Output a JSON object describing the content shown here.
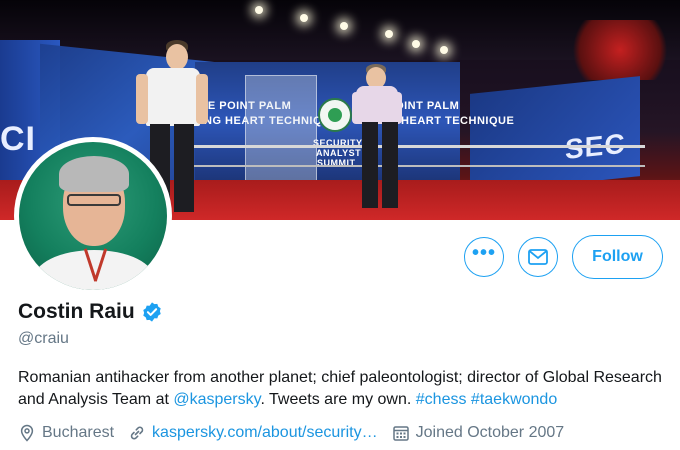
{
  "profile": {
    "display_name": "Costin Raiu",
    "handle": "@craiu",
    "verified_icon": "verified-badge-icon",
    "bio": {
      "text_1": "Romanian antihacker from another planet; chief paleontologist; director of Global Research and Analysis Team at ",
      "mention": "@kaspersky",
      "text_2": ". Tweets are my own. ",
      "hashtag_1": "#chess",
      "hashtag_2": "#taekwondo"
    },
    "location": "Bucharest",
    "website": "kaspersky.com/about/security…",
    "joined": "Joined October 2007"
  },
  "actions": {
    "more_label": "•••",
    "message_icon": "envelope-icon",
    "follow_label": "Follow"
  },
  "banner": {
    "screen_center_line1": "VE POINT PALM",
    "screen_center_line2": "DING HEART TECHNIQUE",
    "screen_left_line1": "VE POINT PALM",
    "screen_left_line2": "DING HEART TECHNIQUE",
    "summit_line1": "SECURITY",
    "summit_line2": "ANALYST",
    "summit_line3": "SUMMIT",
    "big_left": "CI",
    "big_right": "SEC"
  },
  "colors": {
    "accent": "#1da1f2",
    "link": "#1b95e0",
    "muted": "#657786",
    "text": "#14171a"
  }
}
